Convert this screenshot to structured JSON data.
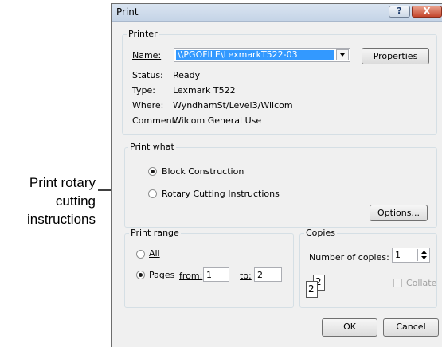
{
  "callout": {
    "lines": [
      "Print rotary",
      "cutting",
      "instructions"
    ]
  },
  "dialog": {
    "title": "Print",
    "help_glyph": "?",
    "close_glyph": "X"
  },
  "printer": {
    "group_label": "Printer",
    "name_label": "Name:",
    "name_value": "\\\\PGOFILE\\LexmarkT522-03",
    "properties_button": "Properties",
    "status_label": "Status:",
    "status_value": "Ready",
    "type_label": "Type:",
    "type_value": "Lexmark T522",
    "where_label": "Where:",
    "where_value": "WyndhamSt/Level3/Wilcom",
    "comment_label": "Comment:",
    "comment_value": "Wilcom General Use"
  },
  "print_what": {
    "group_label": "Print what",
    "option_block": "Block Construction",
    "option_rotary": "Rotary Cutting Instructions",
    "selected": "Block Construction",
    "options_button": "Options..."
  },
  "print_range": {
    "group_label": "Print range",
    "all_label": "All",
    "pages_label": "Pages",
    "selected": "Pages",
    "from_label": "from:",
    "from_value": "1",
    "to_label": "to:",
    "to_value": "2"
  },
  "copies": {
    "group_label": "Copies",
    "number_label": "Number of copies:",
    "number_value": "1",
    "collate_icon_digits": [
      "2",
      "2"
    ],
    "collate_label": "Collate",
    "collate_checked": false
  },
  "buttons": {
    "ok": "OK",
    "cancel": "Cancel"
  }
}
